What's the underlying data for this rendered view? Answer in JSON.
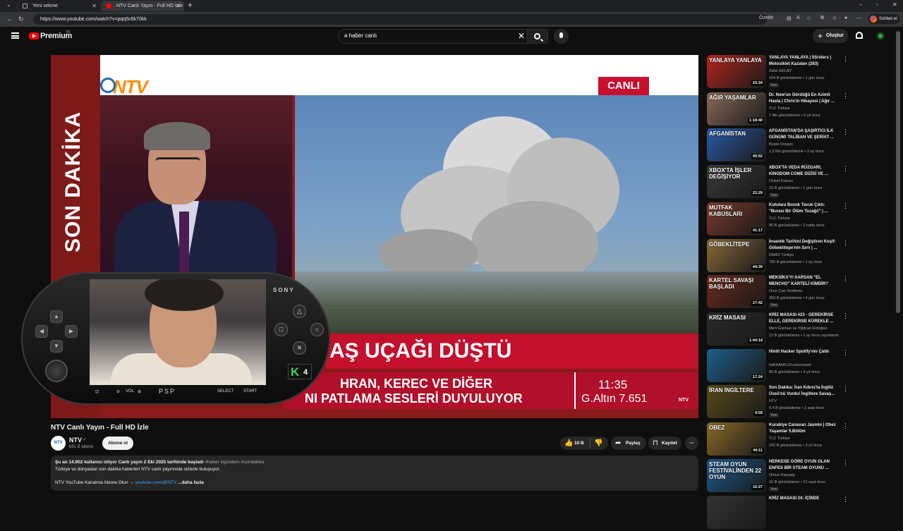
{
  "browser": {
    "tabs": [
      {
        "label": "Yeni sekme"
      },
      {
        "label": "NTV Canlı Yayın - Full HD İzle"
      }
    ],
    "url": "https://www.youtube.com/watch?v=pqq5c6k70kk",
    "toolbar": {
      "summarize": "Özetle",
      "chat": "Sohbet et"
    }
  },
  "youtube": {
    "logo": "Premium",
    "logo_mark": "TR",
    "search_value": "a haber canlı",
    "create_label": "Oluştur"
  },
  "player": {
    "side_text": "SON DAKİKA",
    "brand": "NTV",
    "live_label": "CANLI",
    "headline": "AŞ UÇAĞI DÜŞTÜ",
    "ticker_line1": "HRAN, KEREC VE DİĞER",
    "ticker_line2": "NI PATLAMA SESLERİ DUYULUYOR",
    "time": "11:35",
    "gold": "G.Altın 7.651",
    "mini_logo": "NTV",
    "psp": {
      "brand": "SONY",
      "vol": "VOL",
      "model": "PSP",
      "select": "SELECT",
      "start": "START",
      "k_badge": "K",
      "k_num": "4"
    }
  },
  "video": {
    "title": "NTV Canlı Yayın - Full HD İzle",
    "channel": "NTV",
    "channel_avatar": "NTV",
    "subscribers": "661 B abone",
    "subscribe": "Abone ol",
    "likes": "10 B",
    "share": "Paylaş",
    "save": "Kaydet",
    "desc_meta": "Şu an 14.952 kullanıcı izliyor  Canlı yayın 2 Eki 2025 tarihinde başladı",
    "desc_tags": "#haber #gündem #sondakika",
    "desc_line2": "Türkiye ve dünyadan son dakika haberleri NTV canlı yayınında sizlerle buluşuyor.",
    "desc_line3": "NTV YouTube Kanalına Abone Olun →",
    "desc_link": "youtube.com/@NTV",
    "more": "...daha fazla"
  },
  "recommendations": [
    {
      "title": "YANLAYA YANLAYA | 5Sriders | Motosiklet Kazaları (283)",
      "channel": "Zafer AKCAY",
      "stats": "104 B görüntüleme • 1 gün önce",
      "badge": "Yeni",
      "duration": "15:34",
      "thumb_text": "YANLAYA YANLAYA",
      "color": "#b3261e"
    },
    {
      "title": "Dr. Now'un Gördüğü En Azimli Hasta | Chris'in Hikayesi | Ağır ...",
      "channel": "TLC Türkiye",
      "stats": "1 Mn görüntüleme • 2 yıl önce",
      "badge": "",
      "duration": "1:18:40",
      "thumb_text": "AĞIR YAŞAMLAR",
      "color": "#8a6a58"
    },
    {
      "title": "AFGANİSTAN'DA ŞAŞIRTICI İLK GÜNÜM! TALİBAN VE ŞERİAT ...",
      "channel": "Burak Dorgun",
      "stats": "1,5 Mn görüntüleme • 3 ay önce",
      "badge": "",
      "duration": "40:52",
      "thumb_text": "AFGANİSTAN",
      "color": "#2b5aa8"
    },
    {
      "title": "XBOX'TA VEDA RÜZGARI, KINGDOM COME DİZİSİ VE ...",
      "channel": "Disket Kutusu",
      "stats": "15 B görüntüleme • 1 gün önce",
      "badge": "Yeni",
      "duration": "22:29",
      "thumb_text": "XBOX'TA İŞLER DEĞİŞİYOR",
      "color": "#3a3a3a"
    },
    {
      "title": "Kutulara Bozuk Tavuk Çıktı: \"Burası Bir Ölüm Tuzağı!\" | ...",
      "channel": "TLC Türkiye",
      "stats": "85 B görüntüleme • 2 hafta önce",
      "badge": "",
      "duration": "41:17",
      "thumb_text": "MUTFAK KABUSLARI",
      "color": "#7a3b2a"
    },
    {
      "title": "İnsanlık Tarihini Değiştiren Keşif: Göbeklitepe'nin Sırrı | ...",
      "channel": "DMAX Türkiye",
      "stats": "760 B görüntüleme • 1 ay önce",
      "badge": "",
      "duration": "44:39",
      "thumb_text": "GÖBEKLİTEPE",
      "color": "#8a6a3a"
    },
    {
      "title": "MEKSİKA'YI SARSAN \"EL MENCHO\" KARTELİ KİMDİR?",
      "channel": "Onur Can Yenilmez",
      "stats": "393 B görüntüleme • 4 gün önce",
      "badge": "Yeni",
      "duration": "27:42",
      "thumb_text": "KARTEL SAVAŞI BAŞLADI",
      "color": "#6b2a1a"
    },
    {
      "title": "KRİZ MASASI #23 - GEREKİRSE ELLE, GEREKİRSE KÜREKLE ...",
      "channel": "Mert Günhan ve Yiğitcan Erdoğan",
      "stats": "13 B görüntüleme • 1 ay önce yayınlandı",
      "badge": "",
      "duration": "1:44:14",
      "thumb_text": "KRİZ MASASI",
      "color": "#2a2a2a"
    },
    {
      "title": "Hintli Hacker Spotify'ımı Çaldı",
      "channel": "hdKAANFLIXcehennemi",
      "stats": "86 B görüntüleme • 3 yıl önce",
      "badge": "",
      "duration": "17:24",
      "thumb_text": "",
      "color": "#1f5f8b"
    },
    {
      "title": "Son Dakika: İran Kıbrıs'ta İngiliz Üssü'nü Vurdu! İngiltere Savaş...",
      "channel": "NTV",
      "stats": "9,4 B görüntüleme • 2 saat önce",
      "badge": "Yeni",
      "duration": "9:59",
      "thumb_text": "İRAN İNGİLTERE",
      "color": "#5a4a1a"
    },
    {
      "title": "Kurabiye Canavarı Jasmin | Obez Yaşamlar 5.Bölüm",
      "channel": "TLC Türkiye",
      "stats": "242 B görüntüleme • 3 yıl önce",
      "badge": "",
      "duration": "44:11",
      "thumb_text": "OBEZ",
      "color": "#8b6a2a"
    },
    {
      "title": "HERKESE GÖRE OYUN OLAN ENFES BİR STEAM OYUNU ...",
      "channel": "Orhun Kayaalp",
      "stats": "16 B görüntüleme • 21 saat önce",
      "badge": "Yeni",
      "duration": "16:27",
      "thumb_text": "STEAM OYUN FESTİVALİNDEN 22 OYUN",
      "color": "#1a5a8a"
    },
    {
      "title": "KRİZ MASASI 24: İÇİNDE",
      "channel": "",
      "stats": "",
      "badge": "",
      "duration": "",
      "thumb_text": "",
      "color": "#333333"
    }
  ]
}
